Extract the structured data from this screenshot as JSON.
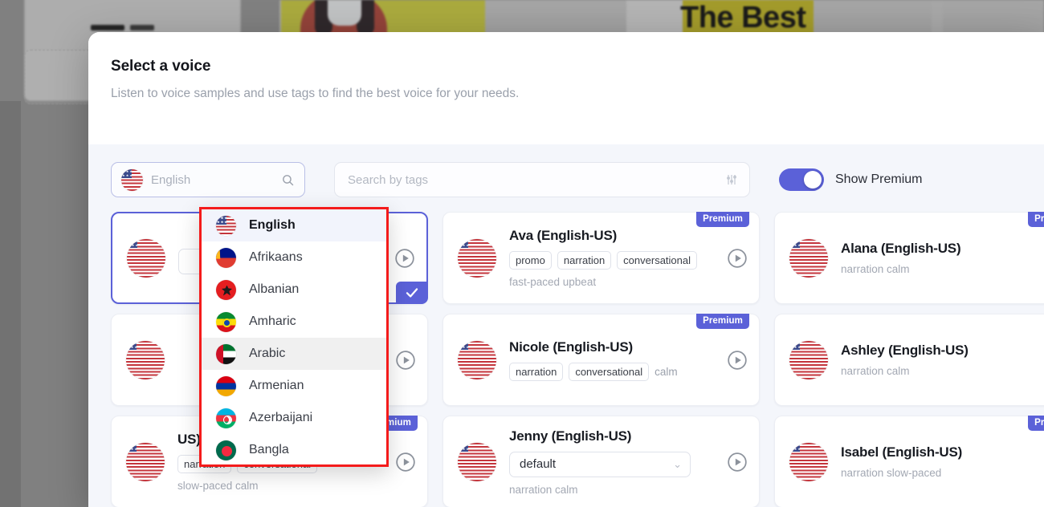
{
  "background": {
    "headline": "The Best",
    "add_button_icon": "plus-icon"
  },
  "modal": {
    "title": "Select a voice",
    "subtitle": "Listen to voice samples and use tags to find the best voice for your needs."
  },
  "filters": {
    "language_value": "English",
    "language_flag": "flag-us",
    "language_search_icon": "search-icon",
    "tags_placeholder": "Search by tags",
    "tags_filter_icon": "sliders-icon",
    "premium_toggle_label": "Show Premium",
    "premium_toggle_on": true,
    "accent_color": "#5b61d8"
  },
  "language_dropdown": {
    "highlight_color": "#f41b1b",
    "items": [
      {
        "label": "English",
        "flag": "flag-us",
        "state": "active"
      },
      {
        "label": "Afrikaans",
        "flag": "flag-za",
        "state": "normal"
      },
      {
        "label": "Albanian",
        "flag": "flag-al",
        "state": "normal"
      },
      {
        "label": "Amharic",
        "flag": "flag-et",
        "state": "normal"
      },
      {
        "label": "Arabic",
        "flag": "flag-ae",
        "state": "hover"
      },
      {
        "label": "Armenian",
        "flag": "flag-am",
        "state": "normal"
      },
      {
        "label": "Azerbaijani",
        "flag": "flag-az",
        "state": "normal"
      },
      {
        "label": "Bangla",
        "flag": "flag-bd",
        "state": "normal"
      }
    ]
  },
  "voices": [
    {
      "name": "",
      "tags": [],
      "desc": "",
      "select_value": "",
      "has_select": true,
      "premium": false,
      "selected": true,
      "occluded": true
    },
    {
      "name": "Ava (English-US)",
      "tags": [
        "promo",
        "narration",
        "conversational"
      ],
      "plain_tags": [],
      "desc": "fast-paced upbeat",
      "has_select": false,
      "premium": true,
      "premium_label": "Premium",
      "selected": false,
      "occluded": false
    },
    {
      "name": "Alana (English-US)",
      "tags": [],
      "plain_tags": [],
      "desc": "narration calm",
      "has_select": false,
      "premium": true,
      "premium_label": "Premium",
      "selected": false,
      "occluded": false
    },
    {
      "name": "",
      "tags": [],
      "desc": "",
      "has_select": false,
      "premium": false,
      "selected": false,
      "occluded": true
    },
    {
      "name": "Nicole (English-US)",
      "tags": [
        "narration",
        "conversational"
      ],
      "plain_tags": [
        "calm"
      ],
      "desc": "",
      "has_select": false,
      "premium": true,
      "premium_label": "Premium",
      "selected": false,
      "occluded": false
    },
    {
      "name": "Ashley (English-US)",
      "tags": [],
      "plain_tags": [],
      "desc": "narration calm",
      "has_select": false,
      "premium": false,
      "selected": false,
      "occluded": false
    },
    {
      "name": "US)",
      "tags": [
        "narration",
        "conversational"
      ],
      "plain_tags": [],
      "desc": "slow-paced calm",
      "has_select": false,
      "premium": true,
      "premium_label": "Premium",
      "selected": false,
      "occluded": true
    },
    {
      "name": "Jenny (English-US)",
      "tags": [],
      "plain_tags": [],
      "desc": "narration calm",
      "has_select": true,
      "select_value": "default",
      "premium": false,
      "selected": false,
      "occluded": false
    },
    {
      "name": "Isabel (English-US)",
      "tags": [],
      "plain_tags": [],
      "desc": "narration slow-paced",
      "has_select": false,
      "premium": true,
      "premium_label": "Premium",
      "selected": false,
      "occluded": false
    }
  ]
}
